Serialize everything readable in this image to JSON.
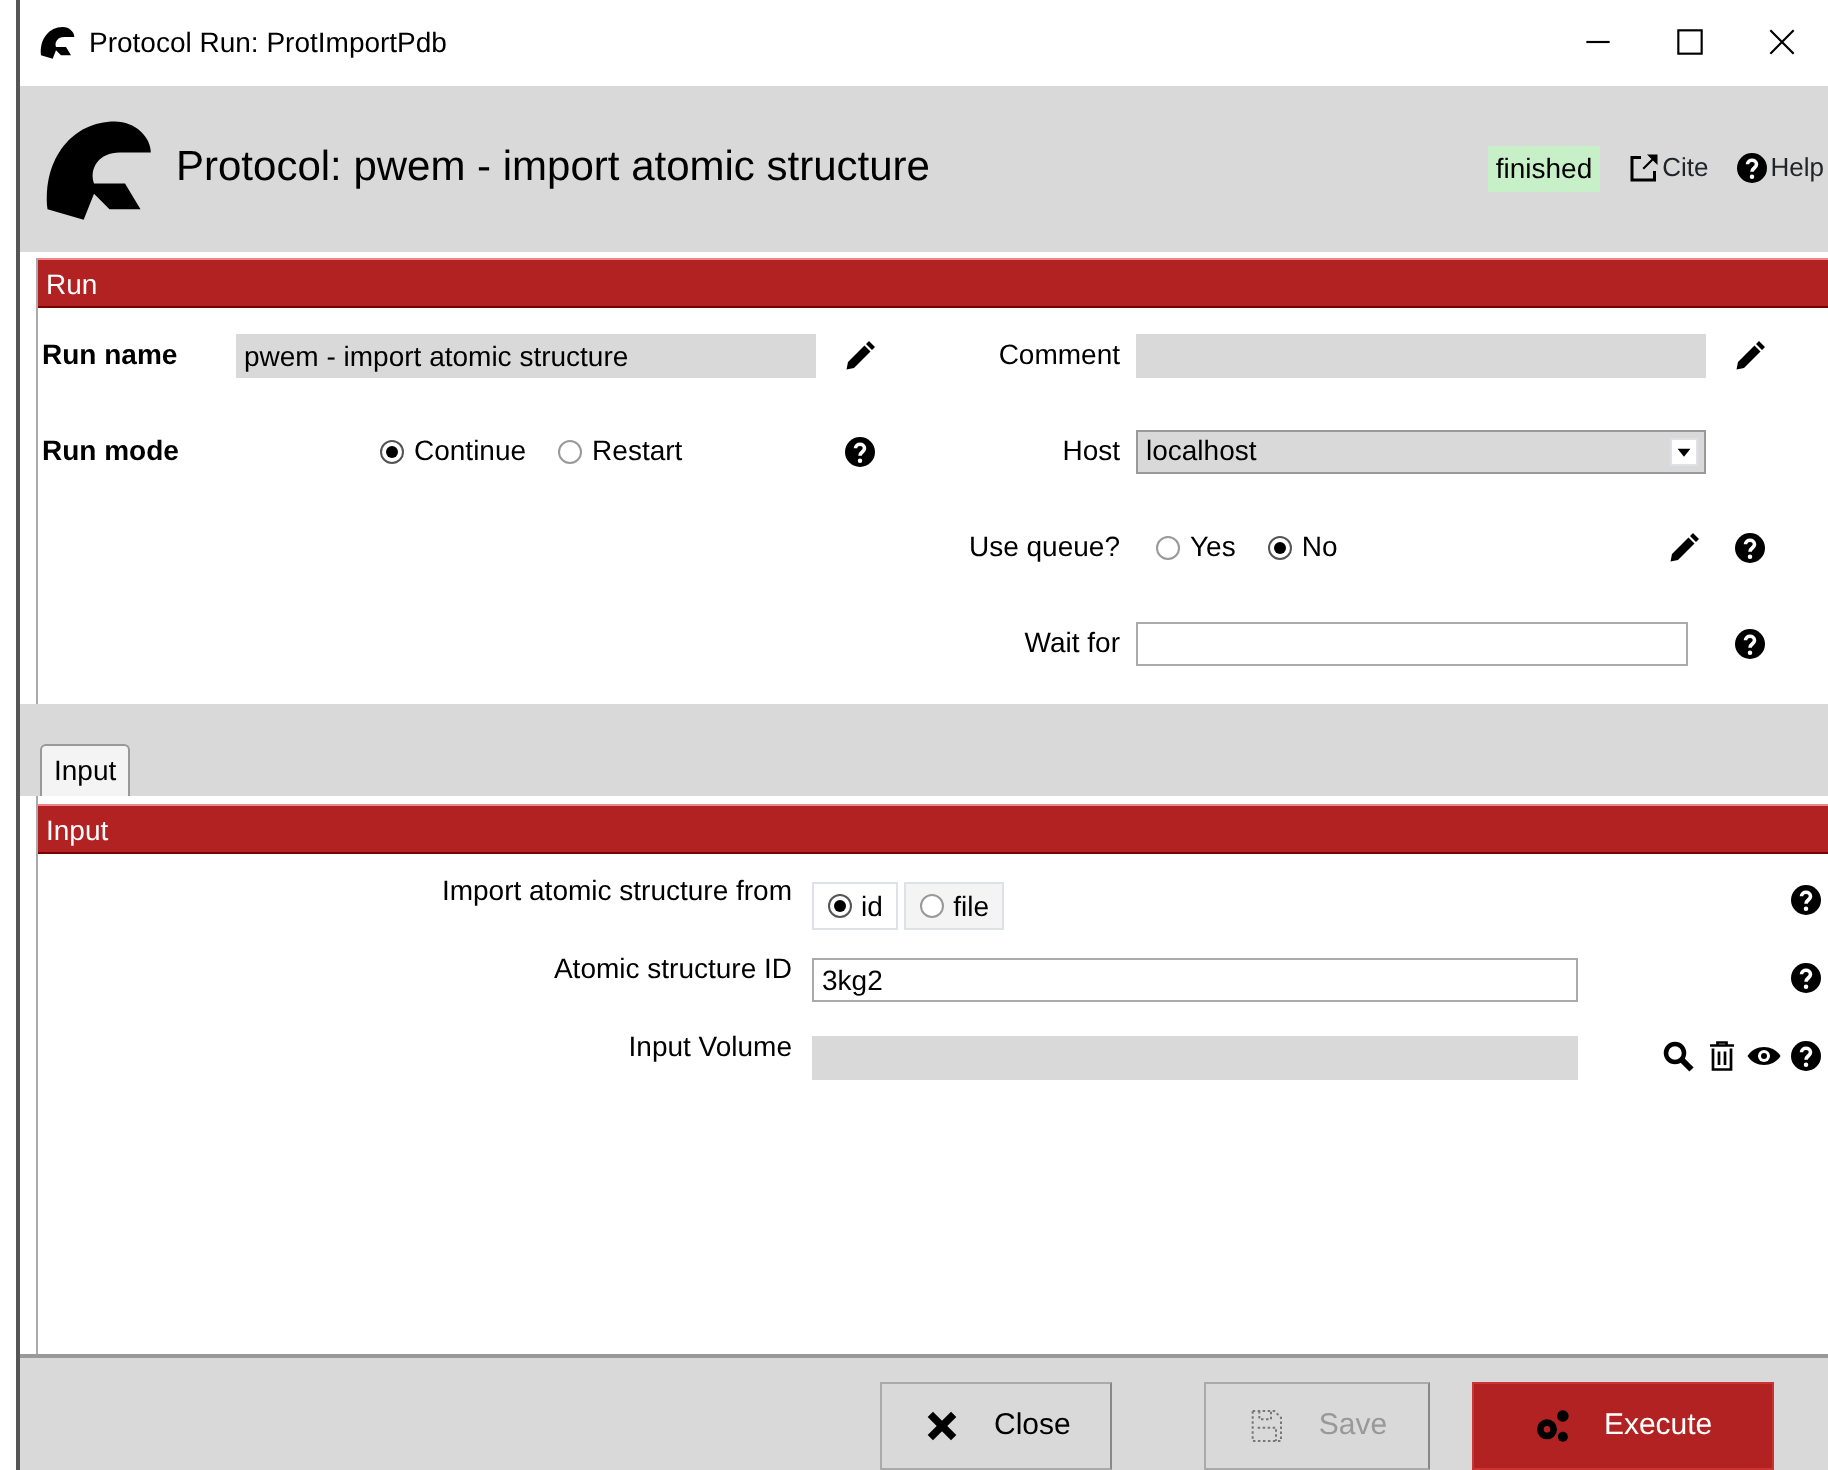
{
  "window": {
    "title": "Protocol Run: ProtImportPdb"
  },
  "header": {
    "title": "Protocol: pwem - import atomic structure",
    "status": "finished",
    "cite": "Cite",
    "help": "Help"
  },
  "run_section": {
    "title": "Run",
    "run_name": {
      "label": "Run name",
      "value": "pwem - import atomic structure"
    },
    "comment": {
      "label": "Comment"
    },
    "run_mode": {
      "label": "Run mode",
      "options": [
        {
          "label": "Continue",
          "selected": true
        },
        {
          "label": "Restart",
          "selected": false
        }
      ]
    },
    "host": {
      "label": "Host",
      "value": "localhost"
    },
    "use_queue": {
      "label": "Use queue?",
      "options": [
        {
          "label": "Yes",
          "selected": false
        },
        {
          "label": "No",
          "selected": true
        }
      ]
    },
    "wait_for": {
      "label": "Wait for"
    }
  },
  "tabs": [
    {
      "label": "Input",
      "selected": true
    }
  ],
  "input_section": {
    "title": "Input",
    "params": [
      {
        "kind": "radio",
        "label": "Import atomic structure from",
        "options": [
          {
            "label": "id",
            "selected": true
          },
          {
            "label": "file",
            "selected": false
          }
        ]
      },
      {
        "kind": "text",
        "label": "Atomic structure ID",
        "value": "3kg2"
      },
      {
        "kind": "pointer",
        "label": "Input Volume"
      }
    ]
  },
  "buttons": [
    {
      "kind": "close",
      "label": "Close",
      "disabled": false
    },
    {
      "kind": "save",
      "label": "Save",
      "disabled": true
    },
    {
      "kind": "execute",
      "label": "Execute",
      "disabled": false
    }
  ]
}
